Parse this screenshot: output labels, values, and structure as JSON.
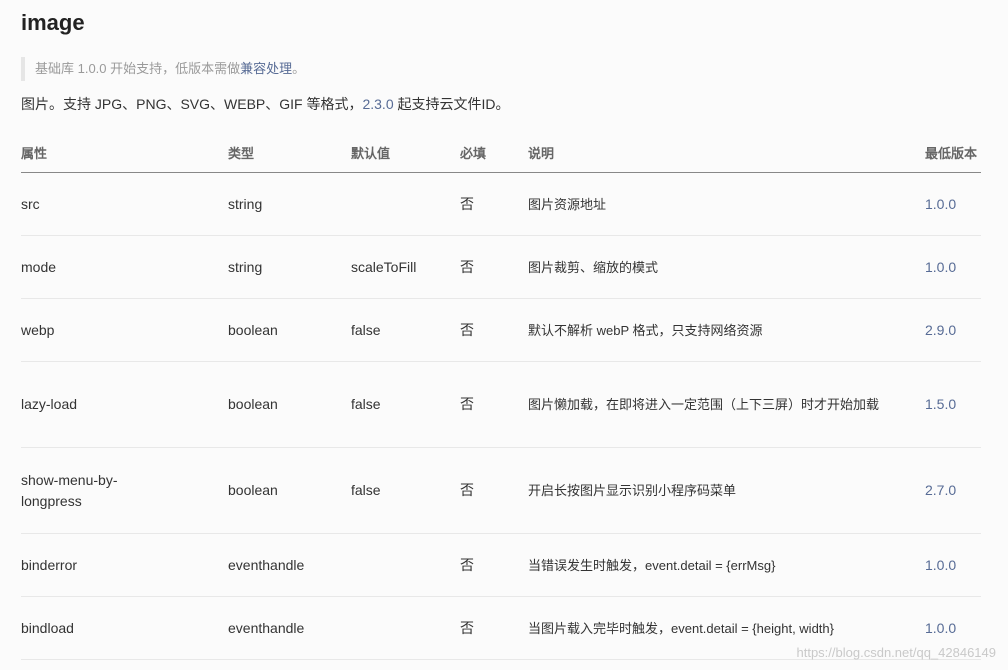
{
  "title": "image",
  "notice": {
    "prefix": "基础库 1.0.0 开始支持，低版本需做",
    "link": "兼容处理",
    "suffix": "。"
  },
  "description": {
    "prefix": "图片。支持 JPG、PNG、SVG、WEBP、GIF 等格式，",
    "version": "2.3.0",
    "suffix": " 起支持云文件ID。"
  },
  "table": {
    "headers": [
      "属性",
      "类型",
      "默认值",
      "必填",
      "说明",
      "最低版本"
    ],
    "rows": [
      {
        "attr": "src",
        "type": "string",
        "default": "",
        "required": "否",
        "note": "图片资源地址",
        "version": "1.0.0"
      },
      {
        "attr": "mode",
        "type": "string",
        "default": "scaleToFill",
        "required": "否",
        "note": "图片裁剪、缩放的模式",
        "version": "1.0.0"
      },
      {
        "attr": "webp",
        "type": "boolean",
        "default": "false",
        "required": "否",
        "note": "默认不解析 webP 格式，只支持网络资源",
        "version": "2.9.0"
      },
      {
        "attr": "lazy-load",
        "type": "boolean",
        "default": "false",
        "required": "否",
        "note": "图片懒加载，在即将进入一定范围（上下三屏）时才开始加载",
        "version": "1.5.0"
      },
      {
        "attr": "show-menu-by-longpress",
        "type": "boolean",
        "default": "false",
        "required": "否",
        "note": "开启长按图片显示识别小程序码菜单",
        "version": "2.7.0"
      },
      {
        "attr": "binderror",
        "type": "eventhandle",
        "default": "",
        "required": "否",
        "note": "当错误发生时触发，event.detail = {errMsg}",
        "version": "1.0.0"
      },
      {
        "attr": "bindload",
        "type": "eventhandle",
        "default": "",
        "required": "否",
        "note": "当图片载入完毕时触发，event.detail = {height, width}",
        "version": "1.0.0"
      }
    ]
  },
  "watermark": "https://blog.csdn.net/qq_42846149"
}
